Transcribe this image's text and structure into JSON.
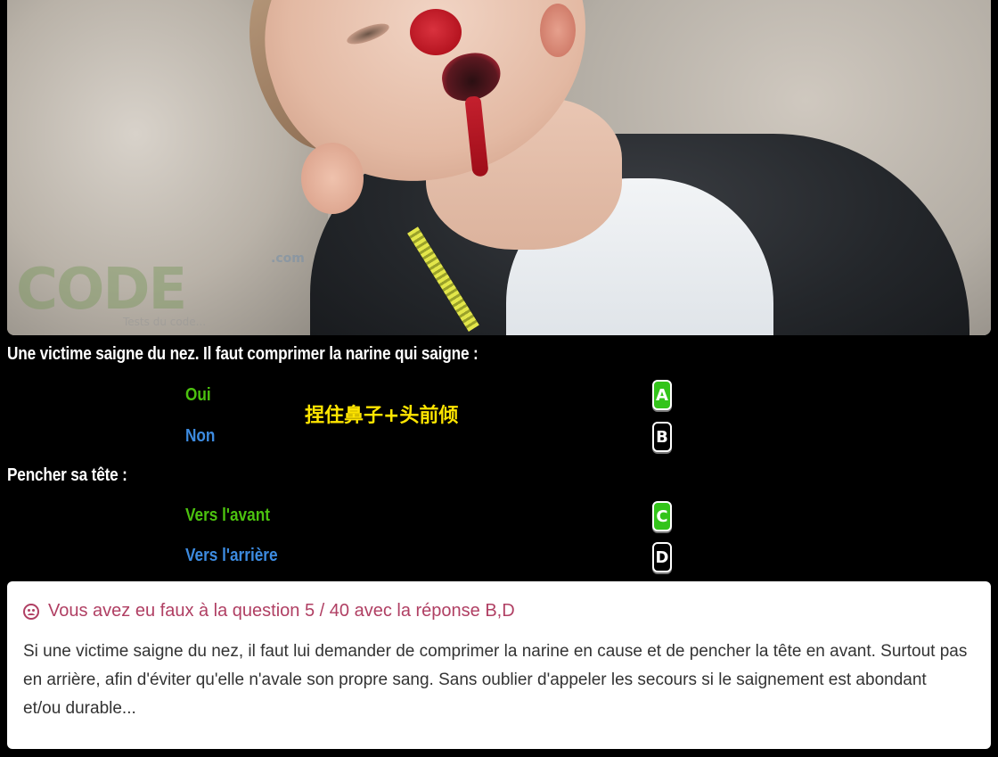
{
  "photo": {
    "watermark_brand": "CODE",
    "watermark_com": ".com",
    "watermark_sub": "Tests du code..."
  },
  "questions": [
    {
      "text": "Une victime saigne du nez. Il faut comprimer la narine qui saigne :",
      "answers": [
        {
          "label": "Oui",
          "key": "A",
          "state": "correct-selected"
        },
        {
          "label": "Non",
          "key": "B",
          "state": "wrong"
        }
      ]
    },
    {
      "text": "Pencher sa tête :",
      "answers": [
        {
          "label": "Vers l'avant",
          "key": "C",
          "state": "correct-selected"
        },
        {
          "label": "Vers l'arrière",
          "key": "D",
          "state": "wrong"
        }
      ]
    }
  ],
  "hint": "捏住鼻子+头前倾",
  "result": {
    "title": "Vous avez eu faux à la question 5 / 40 avec la réponse B,D",
    "body": "Si une victime saigne du nez, il faut lui demander de comprimer la narine en cause et de pencher la tête en avant. Surtout pas en arrière, afin d'éviter qu'elle n'avale son propre sang. Sans oublier d'appeler les secours si le saignement est abondant et/ou durable..."
  },
  "colors": {
    "background": "#000000",
    "correct_answer": "#4cc20f",
    "wrong_answer": "#3d8be0",
    "selected_key": "#33c41a",
    "hint": "#ffe500",
    "error_title": "#b03f63"
  },
  "icons": {
    "result_icon": "sad-face-icon"
  }
}
